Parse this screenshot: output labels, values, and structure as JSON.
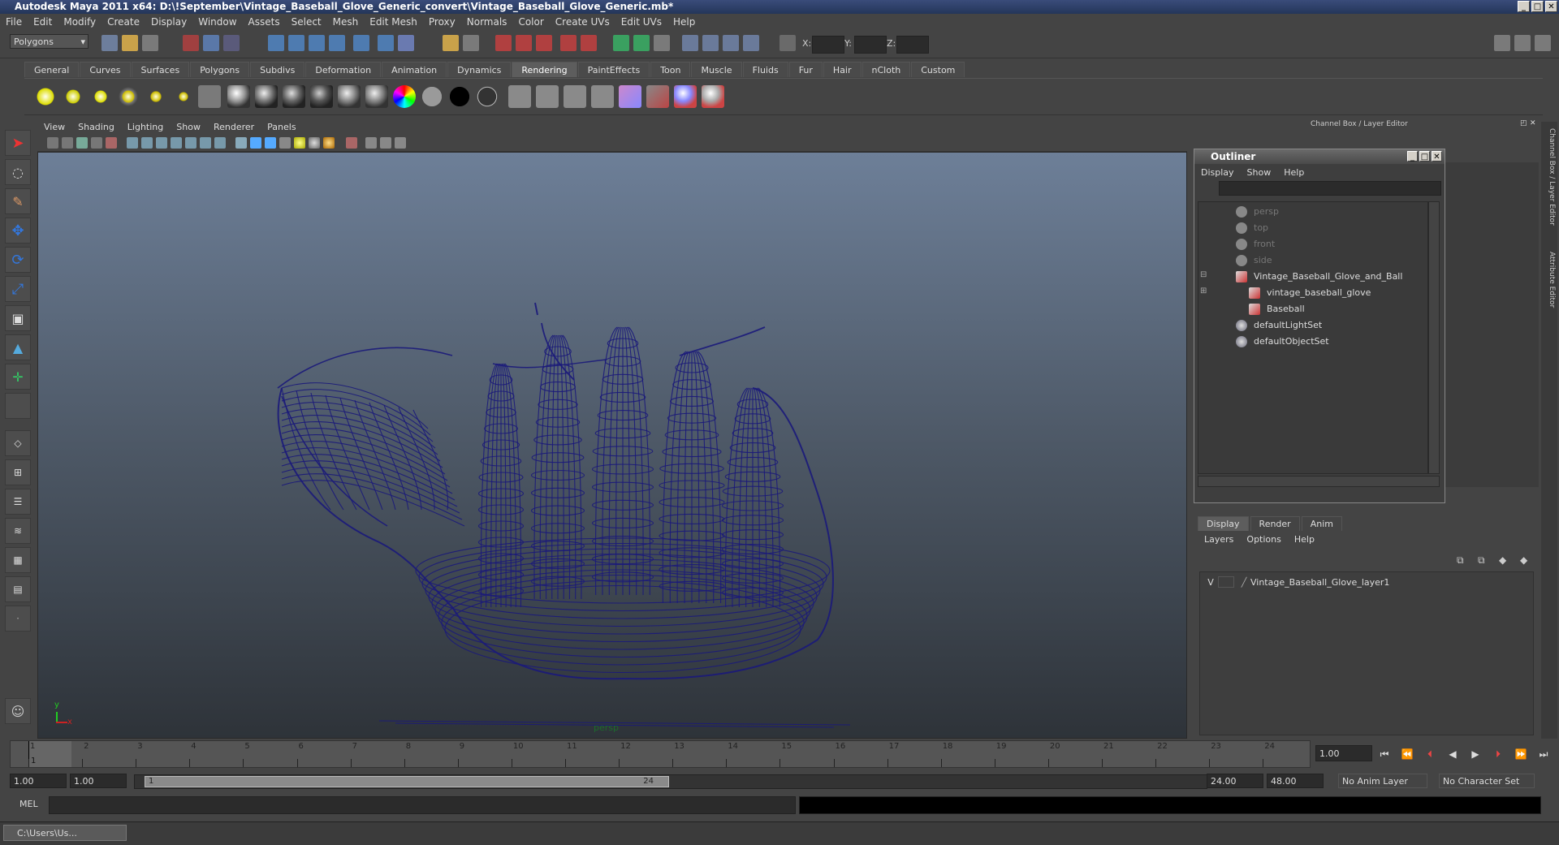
{
  "window": {
    "title": "Autodesk Maya 2011 x64: D:\\!September\\Vintage_Baseball_Glove_Generic_convert\\Vintage_Baseball_Glove_Generic.mb*"
  },
  "menu": [
    "File",
    "Edit",
    "Modify",
    "Create",
    "Display",
    "Window",
    "Assets",
    "Select",
    "Mesh",
    "Edit Mesh",
    "Proxy",
    "Normals",
    "Color",
    "Create UVs",
    "Edit UVs",
    "Help"
  ],
  "status": {
    "mode": "Polygons",
    "x_label": "X:",
    "y_label": "Y:",
    "z_label": "Z:"
  },
  "shelf_tabs": [
    "General",
    "Curves",
    "Surfaces",
    "Polygons",
    "Subdivs",
    "Deformation",
    "Animation",
    "Dynamics",
    "Rendering",
    "PaintEffects",
    "Toon",
    "Muscle",
    "Fluids",
    "Fur",
    "Hair",
    "nCloth",
    "Custom"
  ],
  "shelf_active": "Rendering",
  "viewport": {
    "menu": [
      "View",
      "Shading",
      "Lighting",
      "Show",
      "Renderer",
      "Panels"
    ],
    "camera": "persp",
    "axis_y": "y",
    "axis_x": "x",
    "wire_color": "#1b1a7a"
  },
  "right_panel": {
    "header": "Channel Box / Layer Editor",
    "vtab1": "Channel Box / Layer Editor",
    "vtab2": "Attribute Editor"
  },
  "outliner": {
    "title": "Outliner",
    "menu": [
      "Display",
      "Show",
      "Help"
    ],
    "items": [
      {
        "label": "persp",
        "dim": true,
        "icon": "camera-icon"
      },
      {
        "label": "top",
        "dim": true,
        "icon": "camera-icon"
      },
      {
        "label": "front",
        "dim": true,
        "icon": "camera-icon"
      },
      {
        "label": "side",
        "dim": true,
        "icon": "camera-icon"
      },
      {
        "label": "Vintage_Baseball_Glove_and_Ball",
        "dim": false,
        "icon": "mesh-icon"
      },
      {
        "label": "vintage_baseball_glove",
        "dim": false,
        "icon": "mesh-icon"
      },
      {
        "label": "Baseball",
        "dim": false,
        "icon": "mesh-icon"
      },
      {
        "label": "defaultLightSet",
        "dim": false,
        "icon": "set-icon"
      },
      {
        "label": "defaultObjectSet",
        "dim": false,
        "icon": "set-icon"
      }
    ]
  },
  "layer_editor": {
    "tabs": [
      "Display",
      "Render",
      "Anim"
    ],
    "menu": [
      "Layers",
      "Options",
      "Help"
    ],
    "layer": {
      "visible": "V",
      "name": "Vintage_Baseball_Glove_layer1"
    }
  },
  "timeline": {
    "ticks": [
      "1",
      "2",
      "3",
      "4",
      "5",
      "6",
      "7",
      "8",
      "9",
      "10",
      "11",
      "12",
      "13",
      "14",
      "15",
      "16",
      "17",
      "18",
      "19",
      "20",
      "21",
      "22",
      "23",
      "24"
    ],
    "current_frame": "1.00",
    "start_marker": "1"
  },
  "range": {
    "start": "1.00",
    "anim_start": "1.00",
    "slider_start": "1",
    "slider_end": "24",
    "end": "24.00",
    "anim_end": "48.00",
    "anim_layer": "No Anim Layer",
    "char_set": "No Character Set"
  },
  "cmd": {
    "label": "MEL"
  },
  "taskbar": {
    "item": "C:\\Users\\Us..."
  }
}
